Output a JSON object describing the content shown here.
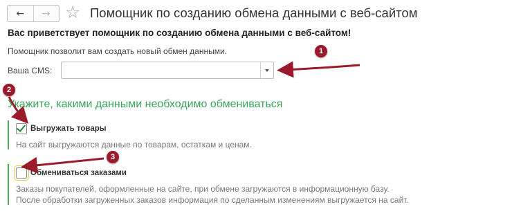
{
  "header": {
    "back_icon": "←",
    "forward_icon": "→",
    "star_icon": "☆",
    "title": "Помощник по созданию обмена данными с веб-сайтом"
  },
  "intro": {
    "welcome": "Вас приветствует помощник по созданию обмена данными с веб-сайтом!",
    "description": "Помощник позволит вам создать новый обмен данными."
  },
  "cms": {
    "label": "Ваша CMS:",
    "value": ""
  },
  "section": {
    "heading": "Укажите, какими данными необходимо обмениваться"
  },
  "options": [
    {
      "label": "Выгружать товары",
      "checked": true,
      "description": [
        "На сайт выгружаются данные по товарам, остаткам и ценам."
      ]
    },
    {
      "label": "Обмениваться заказами",
      "checked": false,
      "description": [
        "Заказы покупателей, оформленные на сайте, при обмене загружаются в информационную базу.",
        "После обработки загруженных заказов информация по сделанным изменениям выгружается на сайт."
      ]
    }
  ],
  "annotations": {
    "badge_1": "1",
    "badge_2": "2",
    "badge_3": "3",
    "color": "#9b1b2c"
  },
  "colors": {
    "accent_green": "#3aa35a",
    "bar_green": "#4caf50"
  }
}
